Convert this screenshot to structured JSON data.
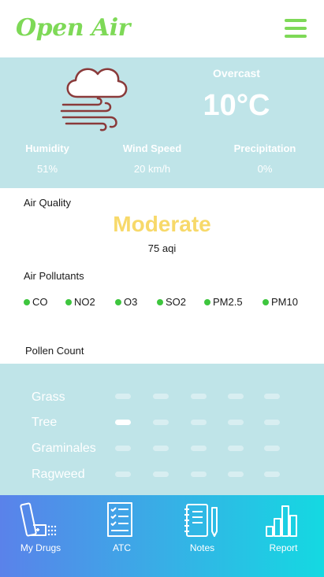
{
  "app": {
    "title": "Open Air"
  },
  "weather": {
    "condition": "Overcast",
    "temperature": "10°C",
    "stats": [
      {
        "label": "Humidity",
        "value": "51%"
      },
      {
        "label": "Wind Speed",
        "value": "20 km/h"
      },
      {
        "label": "Precipitation",
        "value": "0%"
      }
    ]
  },
  "air_quality": {
    "label": "Air Quality",
    "status": "Moderate",
    "aqi": "75 aqi",
    "status_color": "#f7d96a"
  },
  "pollutants": {
    "label": "Air Pollutants",
    "items": [
      "CO",
      "NO2",
      "O3",
      "SO2",
      "PM2.5",
      "PM10"
    ],
    "status_color": "#3ec63e"
  },
  "pollen": {
    "label": "Pollen Count",
    "types": [
      {
        "name": "Grass",
        "level": 0
      },
      {
        "name": "Tree",
        "level": 1
      },
      {
        "name": "Graminales",
        "level": 0
      },
      {
        "name": "Ragweed",
        "level": 0
      }
    ],
    "max_level": 5
  },
  "nav": {
    "items": [
      {
        "label": "My Drugs",
        "icon": "inhaler-icon"
      },
      {
        "label": "ATC",
        "icon": "checklist-icon"
      },
      {
        "label": "Notes",
        "icon": "notebook-icon"
      },
      {
        "label": "Report",
        "icon": "bar-chart-icon"
      }
    ]
  },
  "colors": {
    "brand": "#7ed957",
    "panel": "#bfe4e8"
  }
}
